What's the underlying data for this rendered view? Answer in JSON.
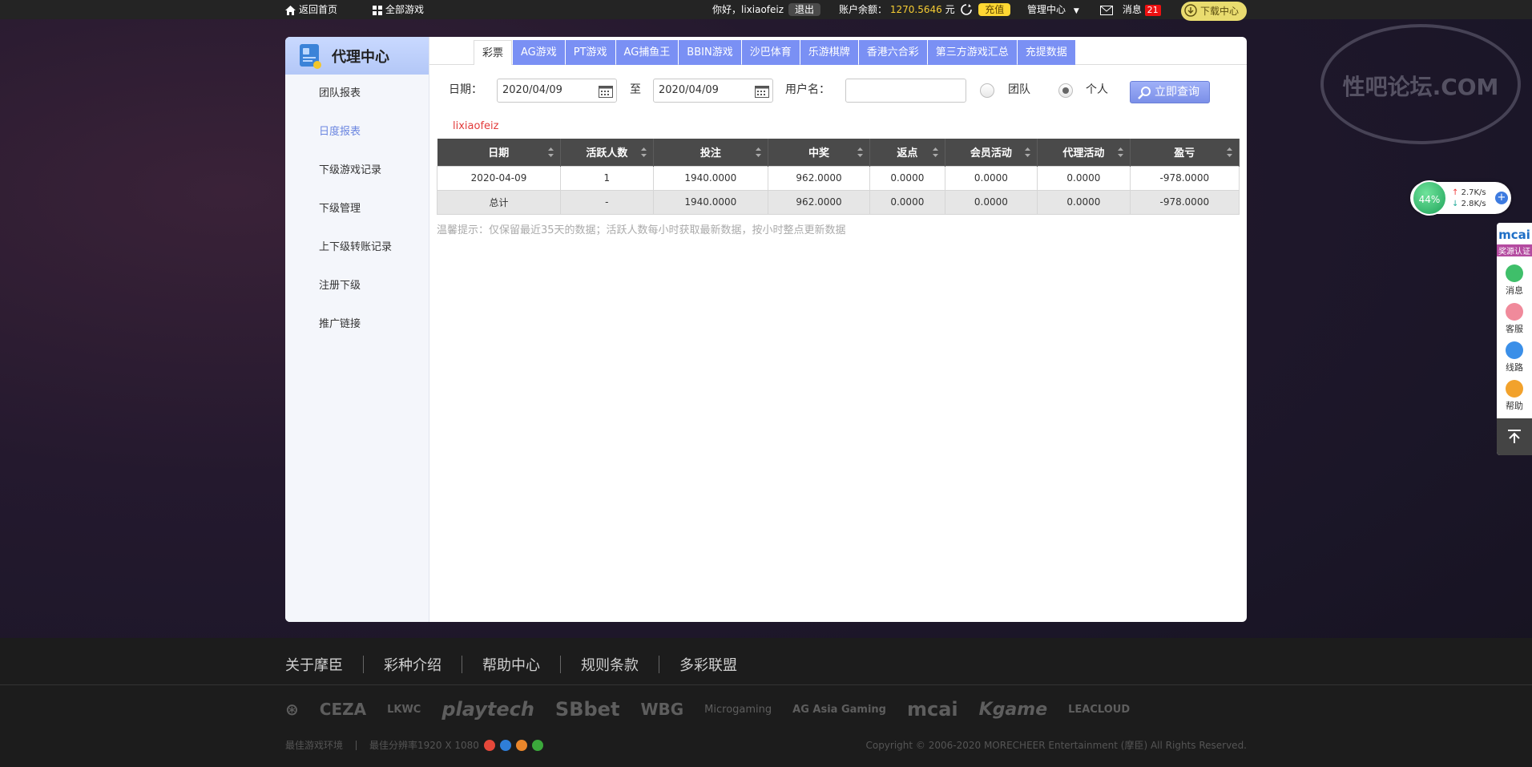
{
  "topbar": {
    "home_label": "返回首页",
    "games_label": "全部游戏",
    "greeting": "你好，lixiaofeiz",
    "logout_label": "退出",
    "balance_label": "账户余额：",
    "balance_value": "1270.5646",
    "balance_unit": "元",
    "recharge_label": "充值",
    "manage_label": "管理中心",
    "message_label": "消息",
    "message_count": "21",
    "download_label": "下载中心"
  },
  "sidebar": {
    "title": "代理中心",
    "items": [
      {
        "label": "团队报表"
      },
      {
        "label": "日度报表"
      },
      {
        "label": "下级游戏记录"
      },
      {
        "label": "下级管理"
      },
      {
        "label": "上下级转账记录"
      },
      {
        "label": "注册下级"
      },
      {
        "label": "推广链接"
      }
    ],
    "active_index": 1
  },
  "tabs": [
    "彩票",
    "AG游戏",
    "PT游戏",
    "AG捕鱼王",
    "BBIN游戏",
    "沙巴体育",
    "乐游棋牌",
    "香港六合彩",
    "第三方游戏汇总",
    "充提数据"
  ],
  "filter": {
    "date_label": "日期：",
    "date_from": "2020/04/09",
    "to_label": "至",
    "date_to": "2020/04/09",
    "username_label": "用户名：",
    "username_value": "",
    "radio_team": "团队",
    "radio_personal": "个人",
    "selected": "个人",
    "query_label": "立即查询"
  },
  "username_tag": "lixiaofeiz",
  "table": {
    "headers": [
      "日期",
      "活跃人数",
      "投注",
      "中奖",
      "返点",
      "会员活动",
      "代理活动",
      "盈亏"
    ],
    "rows": [
      [
        "2020-04-09",
        "1",
        "1940.0000",
        "962.0000",
        "0.0000",
        "0.0000",
        "0.0000",
        "-978.0000"
      ]
    ],
    "total": [
      "总计",
      "-",
      "1940.0000",
      "962.0000",
      "0.0000",
      "0.0000",
      "0.0000",
      "-978.0000"
    ]
  },
  "tip": "温馨提示：仅保留最近35天的数据；活跃人数每小时获取最新数据，按小时整点更新数据",
  "footer": {
    "links": [
      "关于摩臣",
      "彩种介绍",
      "帮助中心",
      "规则条款",
      "多彩联盟"
    ],
    "partners": [
      "CEZA",
      "LKWC",
      "playtech",
      "SBbet",
      "WBG",
      "Microgaming",
      "AG Asia Gaming",
      "mcai",
      "Kgame",
      "LEACLOUD"
    ],
    "env_label": "最佳游戏环境",
    "resolution_label": "最佳分辨率1920 X 1080",
    "copyright": "Copyright © 2006-2020 MORECHEER Entertainment (摩臣) All Rights Reserved."
  },
  "widgets": {
    "speed_percent": "44%",
    "up_speed": "2.7K/s",
    "down_speed": "2.8K/s",
    "logo": "mcai",
    "cert_label": "奖源认证",
    "items": [
      {
        "label": "消息",
        "color": "#3fbf6a"
      },
      {
        "label": "客服",
        "color": "#f08a9b"
      },
      {
        "label": "线路",
        "color": "#3b8fe8"
      },
      {
        "label": "帮助",
        "color": "#f2a22c"
      }
    ]
  },
  "watermark": "性吧论坛.COM"
}
